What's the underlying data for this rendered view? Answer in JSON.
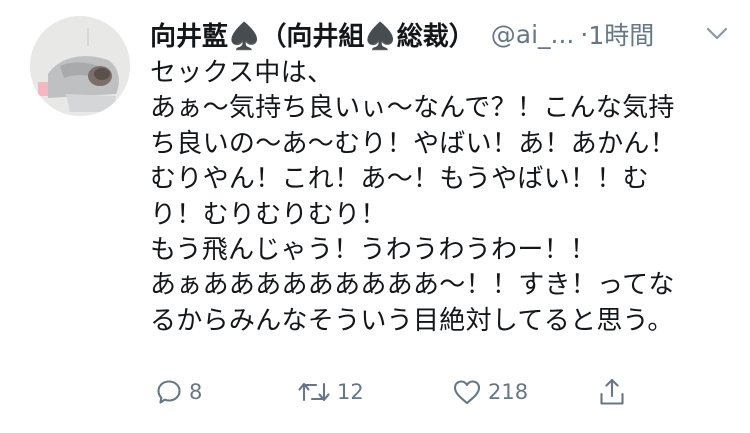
{
  "tweet": {
    "display_name": "向井藍♠️（向井組♠️総裁）",
    "handle": "@ai_...",
    "separator": "·",
    "time": "1時間",
    "body_lines": [
      "セックス中は、",
      "あぁ〜気持ち良いぃ〜なんで？！こんな気持",
      "ち良いの〜あ〜むり！やばい！あ！あかん！",
      "むりやん！これ！あ〜！もうやばい！！む",
      "り！むりむりむり！",
      "もう飛んじゃう！うわうわうわー！！",
      "あぁあああああああああ〜！！すき！ってな",
      "るからみんなそういう目絶対してると思う。"
    ],
    "actions": {
      "reply_count": "8",
      "retweet_count": "12",
      "like_count": "218"
    }
  },
  "icons": {
    "menu": "chevron-down-icon",
    "reply": "reply-icon",
    "retweet": "retweet-icon",
    "like": "heart-icon",
    "share": "share-icon"
  },
  "colors": {
    "text": "#14171a",
    "secondary": "#657786"
  }
}
